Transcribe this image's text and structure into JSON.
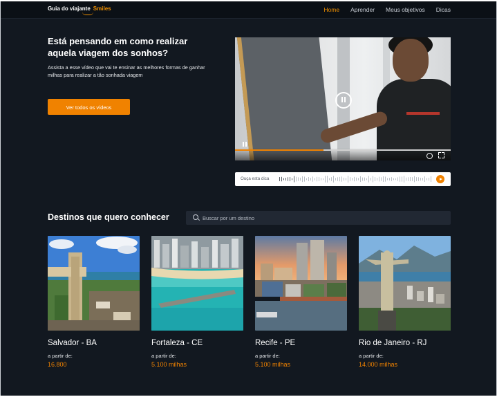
{
  "brand": {
    "name": "Guia do viajante",
    "partner": "Smiles"
  },
  "nav": {
    "items": [
      "Home",
      "Aprender",
      "Meus objetivos",
      "Dicas"
    ],
    "active": "Home"
  },
  "hero": {
    "title": "Está pensando em como realizar aquela viagem dos sonhos?",
    "description": "Assista a esse vídeo que vai te ensinar as melhores formas de ganhar milhas para realizar a tão sonhada viagem",
    "button_label": "Ver todos os vídeos"
  },
  "video": {
    "progress": 0.41
  },
  "audio": {
    "label": "Ouça esta dica"
  },
  "destinations": {
    "title": "Destinos que quero conhecer",
    "search_placeholder": "Buscar por um destino",
    "cards": [
      {
        "name": "Salvador - BA",
        "from_label": "a partir de:",
        "price": "16.800"
      },
      {
        "name": "Fortaleza - CE",
        "from_label": "a partir de:",
        "price": "5.100 milhas"
      },
      {
        "name": "Recife - PE",
        "from_label": "a partir de:",
        "price": "5.100 milhas"
      },
      {
        "name": "Rio de Janeiro - RJ",
        "from_label": "a partir de:",
        "price": "14.000 milhas"
      }
    ]
  },
  "colors": {
    "accent": "#f08200",
    "background": "#121820",
    "topbar": "#0b1016"
  }
}
